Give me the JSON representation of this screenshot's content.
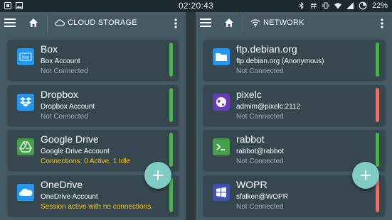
{
  "status_bar": {
    "time": "02:20:43",
    "battery": "22%"
  },
  "left_pane": {
    "title": "Cloud Storage",
    "items": [
      {
        "name": "Box",
        "account": "Box Account",
        "status": "Not Connected",
        "status_color": "#a3b0b6",
        "indicator": "green"
      },
      {
        "name": "Dropbox",
        "account": "Dropbox Account",
        "status": "Not Connected",
        "status_color": "#a3b0b6",
        "indicator": "green"
      },
      {
        "name": "Google Drive",
        "account": "Google Drive Account",
        "status": "Connections: 0 Active, 1 Idle",
        "status_color": "#f5c518",
        "indicator": "green"
      },
      {
        "name": "OneDrive",
        "account": "OneDrive Account",
        "status": "Session active with no connections.",
        "status_color": "#f5c518",
        "indicator": "green"
      }
    ]
  },
  "right_pane": {
    "title": "Network",
    "items": [
      {
        "name": "ftp.debian.org",
        "account": "ftp.debian.org (Anonymous)",
        "status": "Not Connected",
        "status_color": "#a3b0b6",
        "indicator": "green"
      },
      {
        "name": "pixelc",
        "account": "admim@pixelc:2112",
        "status": "Not Connected",
        "status_color": "#a3b0b6",
        "indicator": "red"
      },
      {
        "name": "rabbot",
        "account": "rabbot@rabbot",
        "status": "Not Connected",
        "status_color": "#a3b0b6",
        "indicator": "green"
      },
      {
        "name": "WOPR",
        "account": "sfalken@WOPR",
        "status": "Not Connected",
        "status_color": "#a3b0b6",
        "indicator": "red"
      }
    ]
  },
  "colors": {
    "indicator_green": "#4caf50",
    "indicator_red": "#e57368",
    "fab": "#80cbc4",
    "panel": "#455a64",
    "card": "#37474f"
  }
}
